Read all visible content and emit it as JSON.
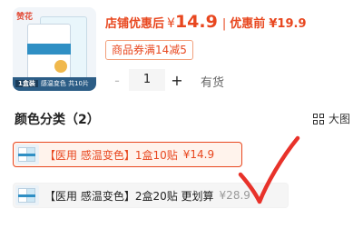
{
  "product": {
    "brand_logo": "赞花",
    "thumb_caption_qty": "1盒装",
    "thumb_caption": "感温变色 共10片"
  },
  "price": {
    "after_label": "店铺优惠后",
    "currency": "¥",
    "after_amount": "14.9",
    "separator": "|",
    "before_label": "优惠前",
    "before_price": "¥19.9"
  },
  "coupon": {
    "label": "商品券满14减5"
  },
  "quantity": {
    "minus": "-",
    "value": "1",
    "plus": "+",
    "stock": "有货"
  },
  "section": {
    "title": "颜色分类（2）",
    "view_label": "大图"
  },
  "options": [
    {
      "label": "【医用 感温变色】1盒10贴",
      "price": "¥14.9",
      "selected": true
    },
    {
      "label": "【医用 感温变色】2盒20贴 更划算",
      "price": "¥28.9",
      "selected": false
    }
  ],
  "colors": {
    "accent": "#e8471f",
    "annotation": "#e8322a"
  }
}
